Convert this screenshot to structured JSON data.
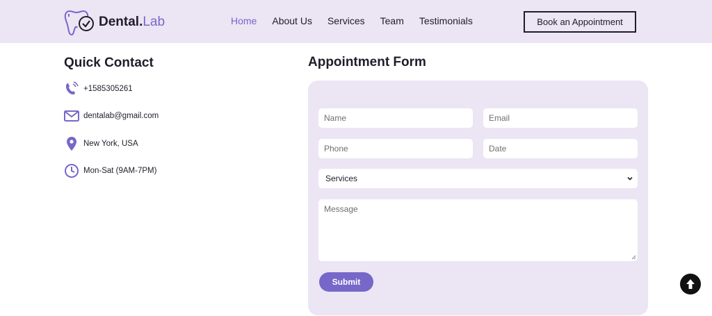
{
  "brand": {
    "name_main": "Dental.",
    "name_accent": "Lab",
    "accent_color": "#7667c9"
  },
  "nav": {
    "links": [
      "Home",
      "About Us",
      "Services",
      "Team",
      "Testimonials"
    ],
    "active": "Home",
    "cta_label": "Book an Appointment"
  },
  "quick_contact": {
    "title": "Quick Contact",
    "items": [
      {
        "icon": "phone-icon",
        "text": "+1585305261"
      },
      {
        "icon": "envelope-icon",
        "text": "dentalab@gmail.com"
      },
      {
        "icon": "location-pin-icon",
        "text": "New York, USA"
      },
      {
        "icon": "clock-icon",
        "text": "Mon-Sat (9AM-7PM)"
      }
    ]
  },
  "appointment_form": {
    "title": "Appointment Form",
    "name_placeholder": "Name",
    "email_placeholder": "Email",
    "phone_placeholder": "Phone",
    "date_placeholder": "Date",
    "services_selected": "Services",
    "message_placeholder": "Message",
    "submit_label": "Submit"
  },
  "colors": {
    "nav_bg": "#ebe5f4",
    "form_bg": "#ebe5f4",
    "accent": "#7667c9",
    "text": "#1f1d2b"
  }
}
